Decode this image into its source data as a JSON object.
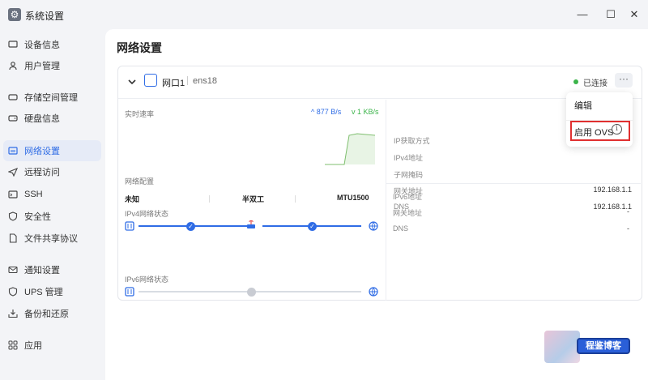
{
  "app": {
    "title": "系统设置",
    "icon": "gear-icon"
  },
  "window_controls": [
    "minimize-icon",
    "maximize-icon",
    "close-icon"
  ],
  "sidebar": {
    "items": [
      {
        "label": "设备信息",
        "icon": "monitor-icon"
      },
      {
        "label": "用户管理",
        "icon": "user-icon"
      },
      {
        "label": "存储空间管理",
        "icon": "storage-icon"
      },
      {
        "label": "硬盘信息",
        "icon": "disk-icon"
      },
      {
        "label": "网络设置",
        "icon": "network-icon",
        "active": true
      },
      {
        "label": "远程访问",
        "icon": "send-icon"
      },
      {
        "label": "SSH",
        "icon": "terminal-icon"
      },
      {
        "label": "安全性",
        "icon": "shield-icon"
      },
      {
        "label": "文件共享协议",
        "icon": "file-icon"
      },
      {
        "label": "通知设置",
        "icon": "mail-icon"
      },
      {
        "label": "UPS 管理",
        "icon": "ups-icon"
      },
      {
        "label": "备份和还原",
        "icon": "backup-icon"
      },
      {
        "label": "应用",
        "icon": "apps-icon"
      }
    ]
  },
  "page_title": "网络设置",
  "port": {
    "name": "网口1",
    "interface": "ens18",
    "status": "已连接",
    "more": "···"
  },
  "realtime": {
    "label": "实时速率",
    "upload": "877 B/s",
    "download": "1 KB/s"
  },
  "network_config": {
    "label": "网络配置",
    "speed": "未知",
    "duplex": "半双工",
    "mtu": "MTU1500"
  },
  "ipv4_status_label": "IPv4网络状态",
  "ipv6_status_label": "IPv6网络状态",
  "details": {
    "ipv4": [
      {
        "label": "IP获取方式",
        "value": ""
      },
      {
        "label": "IPv4地址",
        "value": ""
      },
      {
        "label": "子网掩码",
        "value": ""
      },
      {
        "label": "网关地址",
        "value": "192.168.1.1"
      },
      {
        "label": "DNS",
        "value": "192.168.1.1"
      }
    ],
    "ipv6": [
      {
        "label": "IPv6地址",
        "value": ""
      },
      {
        "label": "网关地址",
        "value": "-"
      },
      {
        "label": "DNS",
        "value": "-"
      }
    ]
  },
  "menu": {
    "edit": "编辑",
    "enable_ovs": "启用 OVS"
  },
  "watermark": {
    "text": "程鉴博客"
  },
  "colors": {
    "accent": "#2f6ce5",
    "success": "#3bb44a",
    "highlight": "#e03030"
  }
}
